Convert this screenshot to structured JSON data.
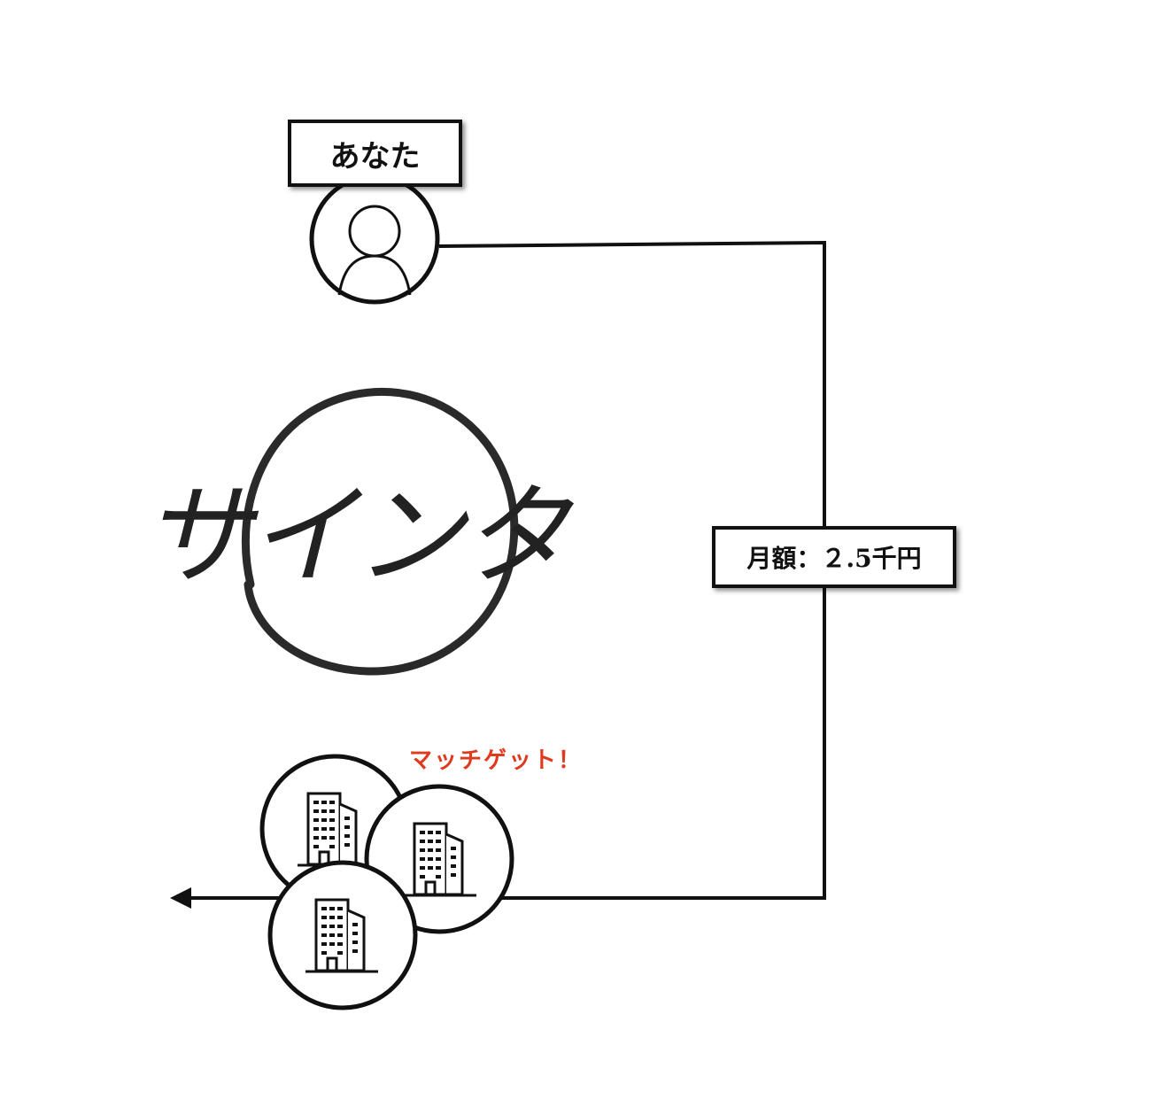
{
  "user": {
    "label": "あなた",
    "icon": "person-icon"
  },
  "logo": {
    "text": "サインタ",
    "icon": "brush-circle-logo"
  },
  "fee": {
    "label": "月額：２.5千円"
  },
  "match": {
    "text": "マッチゲット！",
    "color": "#e03a1e"
  },
  "companies": {
    "icon": "office-building-icon",
    "count": 3
  },
  "colors": {
    "line": "#111111",
    "logo_ink": "#2a2a2a"
  }
}
